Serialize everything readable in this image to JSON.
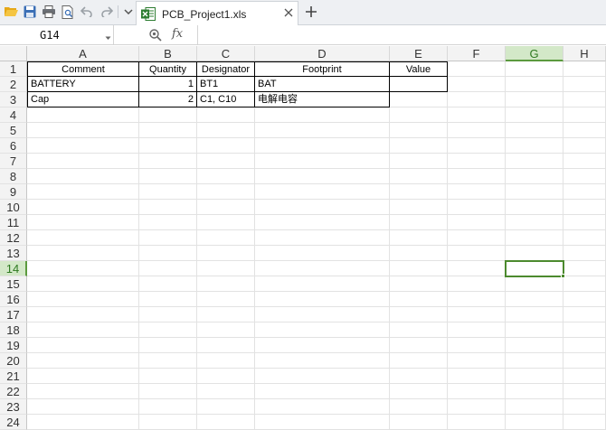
{
  "toolbar": {
    "icons": [
      "open-folder-icon",
      "save-icon",
      "print-icon",
      "print-preview-icon",
      "undo-icon",
      "redo-icon",
      "more-dropdown-icon"
    ]
  },
  "tab": {
    "title": "PCB_Project1.xls",
    "close_icon": "close-icon",
    "add_icon": "plus-icon"
  },
  "formula_bar": {
    "name_box": "G14",
    "fx_label": "fx",
    "formula": ""
  },
  "sheet": {
    "columns": [
      "A",
      "B",
      "C",
      "D",
      "E",
      "F",
      "G",
      "H"
    ],
    "active_column": "G",
    "rows": [
      "1",
      "2",
      "3",
      "4",
      "5",
      "6",
      "7",
      "8",
      "9",
      "10",
      "11",
      "12",
      "13",
      "14",
      "15",
      "16",
      "17",
      "18",
      "19",
      "20",
      "21",
      "22",
      "23",
      "24"
    ],
    "active_row": "14",
    "header_row": [
      "Comment",
      "Quantity",
      "Designator",
      "Footprint",
      "Value"
    ],
    "data_rows": [
      [
        "BATTERY",
        "1",
        "BT1",
        "BAT",
        ""
      ],
      [
        "Cap",
        "2",
        "C1, C10",
        "电解电容",
        ""
      ]
    ]
  },
  "colors": {
    "accent_green": "#4c8a2e",
    "active_header_bg": "#d3e8c8"
  }
}
